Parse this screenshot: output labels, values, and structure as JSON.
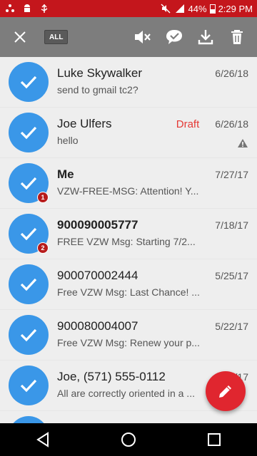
{
  "status_bar": {
    "left_icons": [
      "dots-icon",
      "android-icon",
      "usb-icon"
    ],
    "battery_percent": "44%",
    "time": "2:29 PM"
  },
  "action_bar": {
    "all_label": "ALL"
  },
  "conversations": [
    {
      "name": "Luke Skywalker",
      "snippet": "send to gmail tc2?",
      "date": "6/26/18",
      "bold": false,
      "badge": "",
      "draft": "",
      "warning": false
    },
    {
      "name": "Joe Ulfers",
      "snippet": "hello",
      "date": "6/26/18",
      "bold": false,
      "badge": "",
      "draft": "Draft",
      "warning": true
    },
    {
      "name": "Me",
      "snippet": "VZW-FREE-MSG: Attention! Y...",
      "date": "7/27/17",
      "bold": true,
      "badge": "1",
      "draft": "",
      "warning": false
    },
    {
      "name": "900090005777",
      "snippet": "FREE VZW Msg: Starting 7/2...",
      "date": "7/18/17",
      "bold": true,
      "badge": "2",
      "draft": "",
      "warning": false
    },
    {
      "name": "900070002444",
      "snippet": "Free VZW Msg: Last Chance! ...",
      "date": "5/25/17",
      "bold": false,
      "badge": "",
      "draft": "",
      "warning": false
    },
    {
      "name": "900080004007",
      "snippet": "Free VZW Msg: Renew your p...",
      "date": "5/22/17",
      "bold": false,
      "badge": "",
      "draft": "",
      "warning": false
    },
    {
      "name": "Joe, (571) 555-0112",
      "snippet": "All are correctly oriented in a ...",
      "date": "5/9/17",
      "bold": false,
      "badge": "",
      "draft": "",
      "warning": false
    }
  ],
  "colors": {
    "status_bar": "#c4161c",
    "action_bar": "#7d7d7d",
    "avatar_selected": "#3a97e8",
    "fab": "#e0262f",
    "draft": "#e53935"
  }
}
